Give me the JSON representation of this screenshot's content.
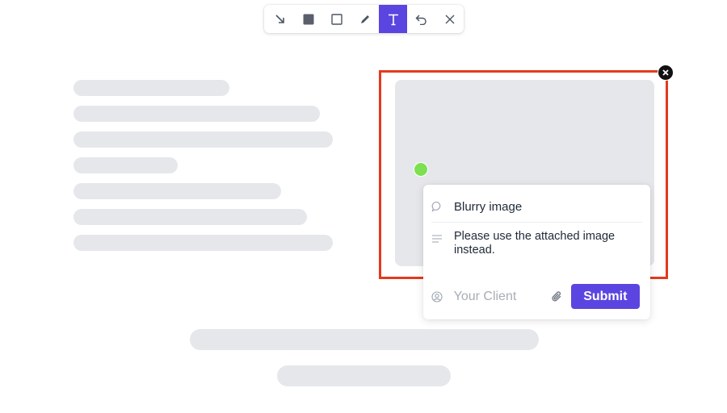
{
  "toolbar": {
    "tools": [
      {
        "name": "arrow",
        "icon": "arrow-down-right-icon",
        "active": false
      },
      {
        "name": "filled-rectangle",
        "icon": "filled-square-icon",
        "active": false
      },
      {
        "name": "rectangle",
        "icon": "square-outline-icon",
        "active": false
      },
      {
        "name": "pen",
        "icon": "pencil-icon",
        "active": false
      },
      {
        "name": "text",
        "icon": "text-t-icon",
        "active": true
      },
      {
        "name": "undo",
        "icon": "undo-icon",
        "active": false
      },
      {
        "name": "close",
        "icon": "close-icon",
        "active": false
      }
    ],
    "active_color": "#5b45e0"
  },
  "annotation": {
    "border_color": "#e5391e",
    "pin_color": "#7ce050"
  },
  "comment": {
    "title": "Blurry image",
    "description": "Please use the attached image instead.",
    "client_placeholder": "Your Client",
    "client_value": "",
    "submit_label": "Submit",
    "title_icon": "chat-bubble-icon",
    "description_icon": "text-lines-icon",
    "client_icon": "user-circle-icon",
    "attach_icon": "paperclip-icon"
  }
}
